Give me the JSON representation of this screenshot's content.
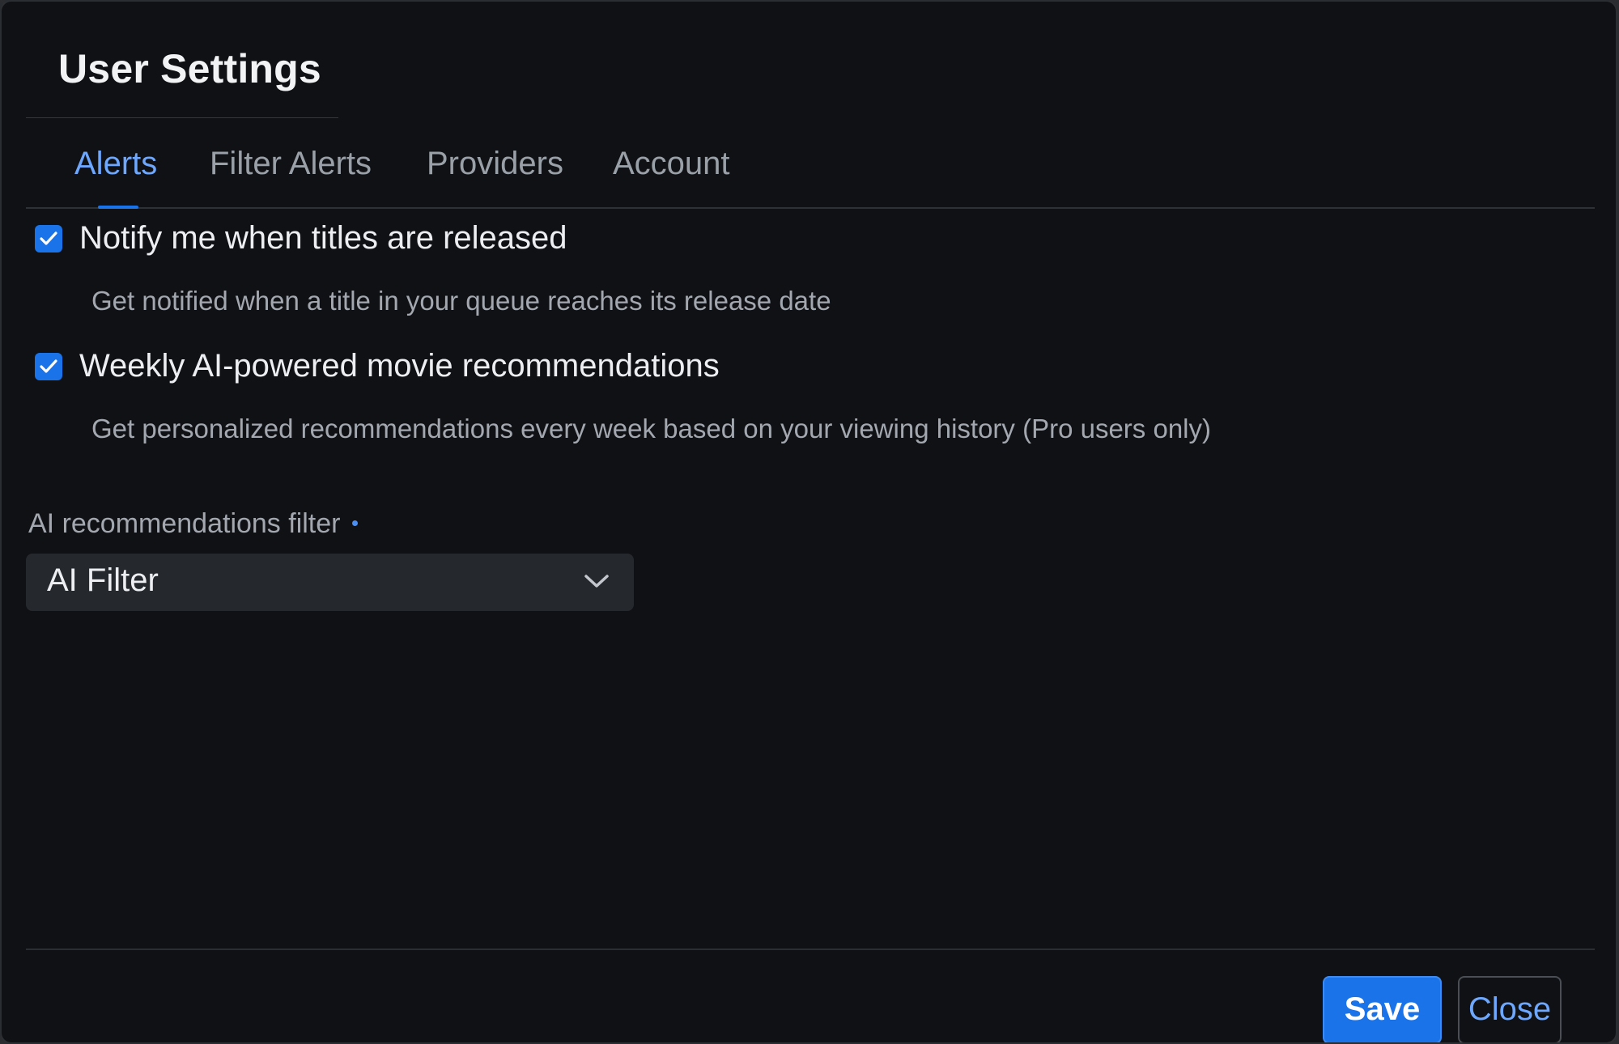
{
  "dialog": {
    "title": "User Settings"
  },
  "tabs": [
    {
      "label": "Alerts",
      "active": true
    },
    {
      "label": "Filter Alerts",
      "active": false
    },
    {
      "label": "Providers",
      "active": false
    },
    {
      "label": "Account",
      "active": false
    }
  ],
  "alerts": {
    "options": [
      {
        "label": "Notify me when titles are released",
        "description": "Get notified when a title in your queue reaches its release date",
        "checked": true
      },
      {
        "label": "Weekly AI-powered movie recommendations",
        "description": "Get personalized recommendations every week based on your viewing history (Pro users only)",
        "checked": true
      }
    ],
    "filter": {
      "label": "AI recommendations filter",
      "required": true,
      "selected": "AI Filter"
    }
  },
  "footer": {
    "save_label": "Save",
    "close_label": "Close"
  },
  "colors": {
    "accent": "#1a73e8",
    "link": "#6ea8fe",
    "background": "#101114",
    "surface": "#25282d"
  }
}
